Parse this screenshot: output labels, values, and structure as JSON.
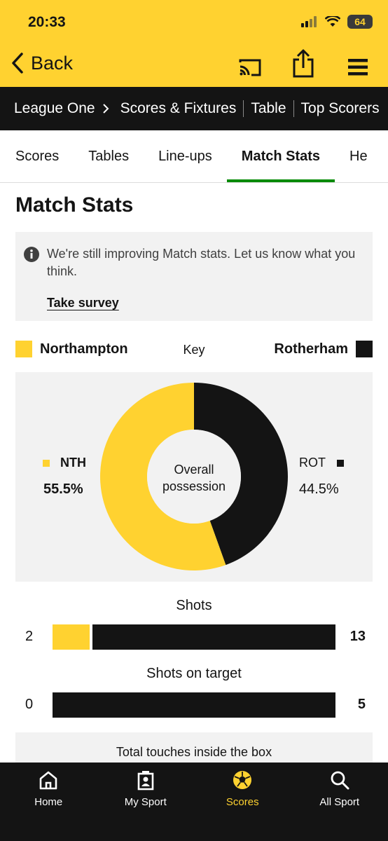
{
  "status_bar": {
    "time": "20:33",
    "battery": "64"
  },
  "header": {
    "back_label": "Back"
  },
  "breadcrumb": {
    "items": [
      "League One",
      "Scores & Fixtures",
      "Table",
      "Top Scorers"
    ]
  },
  "tabs": [
    "Scores",
    "Tables",
    "Line-ups",
    "Match Stats",
    "He"
  ],
  "active_tab": "Match Stats",
  "page": {
    "title": "Match Stats"
  },
  "notice": {
    "text": "We're still improving Match stats. Let us know what you think.",
    "link": "Take survey"
  },
  "key": {
    "home_team": "Northampton",
    "label": "Key",
    "away_team": "Rotherham",
    "home_color": "#ffd230",
    "away_color": "#141414"
  },
  "possession": {
    "center_line1": "Overall",
    "center_line2": "possession",
    "home_abbr": "NTH",
    "home_pct": "55.5%",
    "away_abbr": "ROT",
    "away_pct": "44.5%"
  },
  "chart_data": [
    {
      "type": "pie",
      "title": "Overall possession",
      "categories": [
        "NTH",
        "ROT"
      ],
      "values": [
        55.5,
        44.5
      ],
      "colors": [
        "#ffd230",
        "#141414"
      ]
    },
    {
      "type": "bar",
      "title": "Shots",
      "series": [
        {
          "name": "NTH",
          "values": [
            2
          ]
        },
        {
          "name": "ROT",
          "values": [
            13
          ]
        }
      ]
    },
    {
      "type": "bar",
      "title": "Shots on target",
      "series": [
        {
          "name": "NTH",
          "values": [
            0
          ]
        },
        {
          "name": "ROT",
          "values": [
            5
          ]
        }
      ]
    }
  ],
  "stats": [
    {
      "title": "Shots",
      "home": "2",
      "away": "13",
      "home_value": 2,
      "away_value": 13
    },
    {
      "title": "Shots on target",
      "home": "0",
      "away": "5",
      "home_value": 0,
      "away_value": 5
    }
  ],
  "next_stat": {
    "title": "Total touches inside the box"
  },
  "bottom_nav": [
    {
      "label": "Home",
      "icon": "house-icon"
    },
    {
      "label": "My Sport",
      "icon": "person-card-icon"
    },
    {
      "label": "Scores",
      "icon": "football-icon"
    },
    {
      "label": "All Sport",
      "icon": "search-icon"
    }
  ],
  "active_nav": "Scores"
}
